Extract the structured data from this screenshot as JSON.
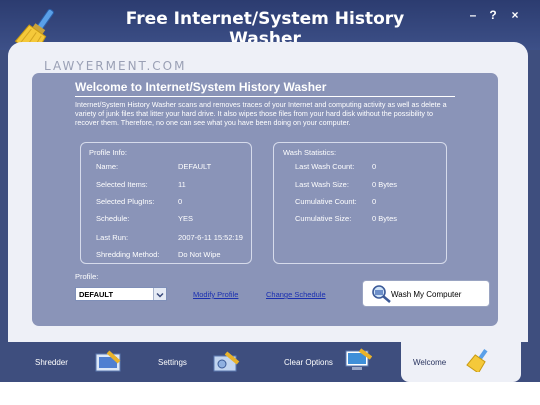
{
  "app": {
    "title": "Free Internet/System History Washer",
    "watermark": "LAWYERMENT.COM",
    "window_buttons": {
      "minimize": "–",
      "help": "?",
      "close": "×"
    }
  },
  "welcome": {
    "title": "Welcome to Internet/System History Washer",
    "description": "Internet/System History Washer scans and removes traces of your Internet and computing activity as well as delete a variety of junk files that litter your hard drive. It also wipes those files from your hard disk without the possibility to recover them. Therefore, no one can see what you have been doing on your computer."
  },
  "profile_info": {
    "title": "Profile Info:",
    "rows": [
      {
        "label": "Name:",
        "value": "DEFAULT"
      },
      {
        "label": "Selected Items:",
        "value": "11"
      },
      {
        "label": "Selected PlugIns:",
        "value": "0"
      },
      {
        "label": "Schedule:",
        "value": "YES"
      },
      {
        "label": "Last Run:",
        "value": "2007-6-11 15:52:19"
      },
      {
        "label": "Shredding Method:",
        "value": "Do Not Wipe"
      }
    ]
  },
  "wash_stats": {
    "title": "Wash Statistics:",
    "rows": [
      {
        "label": "Last Wash Count:",
        "value": "0"
      },
      {
        "label": "Last Wash Size:",
        "value": "0 Bytes"
      },
      {
        "label": "Cumulative Count:",
        "value": "0"
      },
      {
        "label": "Cumulative Size:",
        "value": "0 Bytes"
      }
    ]
  },
  "profile": {
    "label": "Profile:",
    "selected": "DEFAULT",
    "modify_link": "Modify Profile",
    "schedule_link": "Change Schedule"
  },
  "wash_button": {
    "label": "Wash My Computer"
  },
  "tabs": [
    {
      "label": "Shredder",
      "icon": "shredder-icon"
    },
    {
      "label": "Settings",
      "icon": "settings-icon"
    },
    {
      "label": "Clear Options",
      "icon": "clear-options-icon"
    },
    {
      "label": "Welcome",
      "icon": "broom-icon",
      "active": true
    }
  ]
}
